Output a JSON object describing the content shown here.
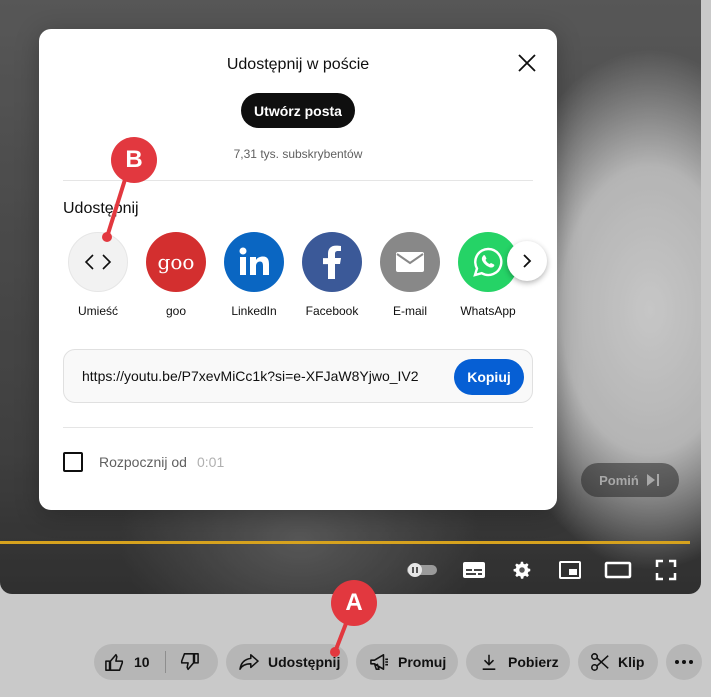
{
  "dialog": {
    "title": "Udostępnij w poście",
    "create_post_label": "Utwórz posta",
    "subscribers": "7,31 tys. subskrybentów",
    "share_label": "Udostępnij",
    "targets": [
      {
        "label": "Umieść",
        "icon": "embed-icon",
        "color": "#f2f2f2"
      },
      {
        "label": "goo",
        "icon": "goo-icon",
        "color": "#d32f2f"
      },
      {
        "label": "LinkedIn",
        "icon": "linkedin-icon",
        "color": "#0a66c2"
      },
      {
        "label": "Facebook",
        "icon": "facebook-icon",
        "color": "#3b5998"
      },
      {
        "label": "E-mail",
        "icon": "email-icon",
        "color": "#888888"
      },
      {
        "label": "WhatsApp",
        "icon": "whatsapp-icon",
        "color": "#25d366"
      }
    ],
    "goo_icon_text": "goo",
    "url": "https://youtu.be/P7xevMiCc1k?si=e-XFJaW8Yjwo_IV2",
    "copy_label": "Kopiuj",
    "start_at_label": "Rozpocznij od",
    "start_at_time": "0:01"
  },
  "player": {
    "skip_label": "Pomiń"
  },
  "actions": {
    "like_count": "10",
    "share_label": "Udostępnij",
    "promote_label": "Promuj",
    "download_label": "Pobierz",
    "clip_label": "Klip"
  },
  "annotations": {
    "a": "A",
    "b": "B"
  },
  "colors": {
    "accent_blue": "#065fd4",
    "marker_red": "#e2383f",
    "progress": "#d6a21e"
  }
}
